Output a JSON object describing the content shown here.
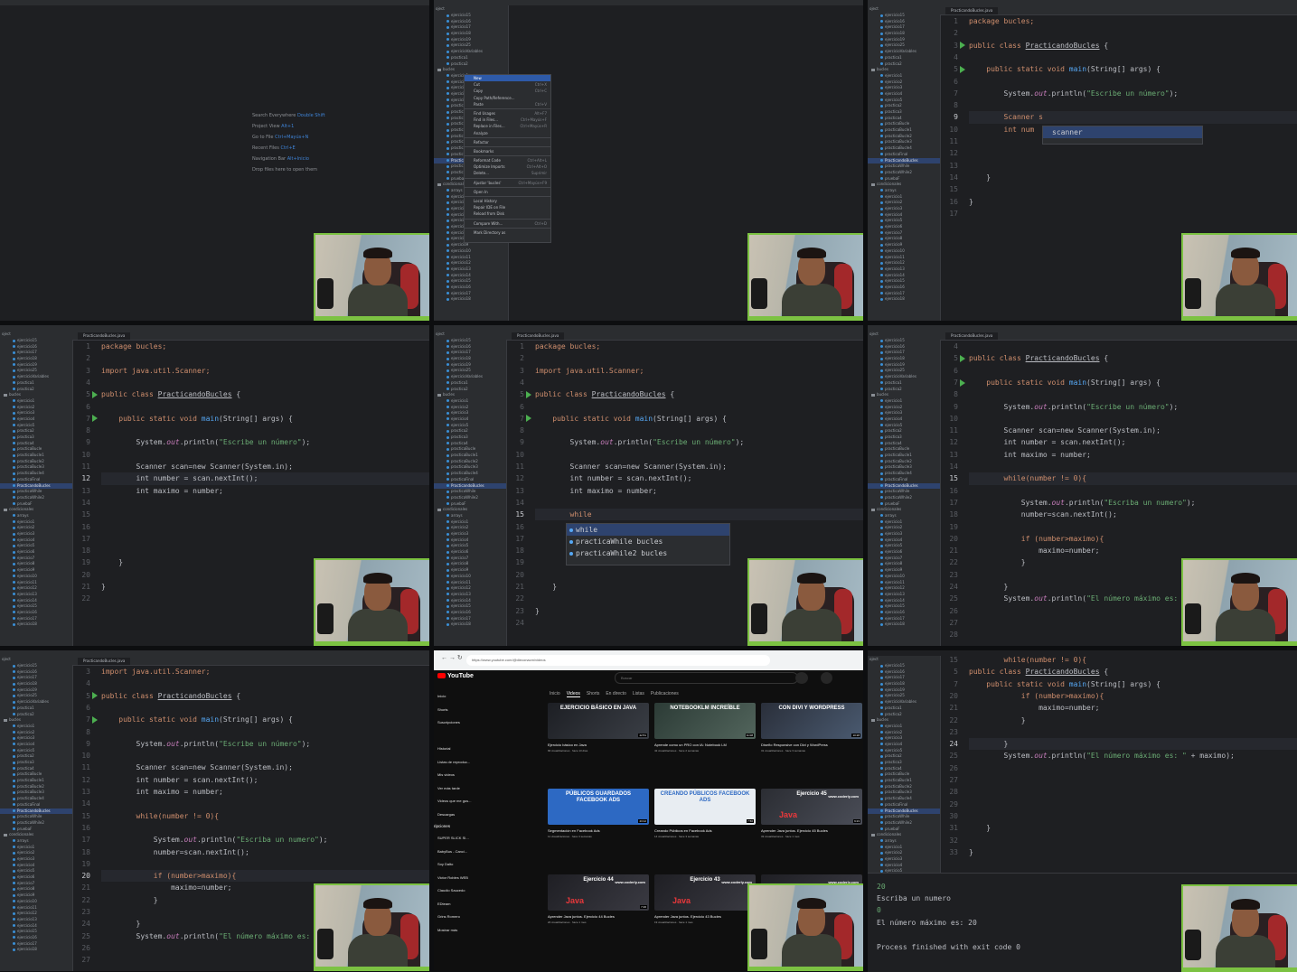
{
  "project_header": "oject",
  "editor_tab": "PracticandoBucles.java",
  "tree_top": [
    "ejercicio15",
    "ejercicio16",
    "ejercicio17",
    "ejercicio18",
    "ejercicio19",
    "ejercicio25",
    "ejercicioVariables",
    "practica1",
    "practica2"
  ],
  "tree_bucles": "bucles",
  "tree_bucles_items": [
    "ejercicio1",
    "ejercicio2",
    "ejercicio3",
    "ejercicio4",
    "ejercicio5",
    "practica2",
    "practica3",
    "practica4",
    "practicaBucle",
    "practicaBucle1",
    "practicaBucle2",
    "practicaBucle3",
    "practicaBucle4",
    "practicaFinal",
    "PracticandoBucles",
    "practicaWhile",
    "practicaWhile2",
    "pruebaF"
  ],
  "tree_condicionales": "condicionales",
  "tree_cond_items": [
    "arrays",
    "ejercicio1",
    "ejercicio2",
    "ejercicio3",
    "ejercicio4",
    "ejercicio5",
    "ejercicio6",
    "ejercicio7",
    "ejercicio8",
    "ejercicio9",
    "ejercicio10",
    "ejercicio11",
    "ejercicio12",
    "ejercicio13",
    "ejercicio14",
    "ejercicio15",
    "ejercicio16",
    "ejercicio17",
    "ejercicio18"
  ],
  "welcome": {
    "search_everywhere": "Search Everywhere",
    "search_everywhere_key": "Double Shift",
    "project_view": "Project View",
    "project_view_key": "Alt+1",
    "goto_file": "Go to File",
    "goto_file_key": "Ctrl+Mayús+N",
    "recent_files": "Recent Files",
    "recent_files_key": "Ctrl+E",
    "nav_bar": "Navigation Bar",
    "nav_bar_key": "Alt+Inicio",
    "drop_files": "Drop files here to open them"
  },
  "context_menu": [
    {
      "label": "New",
      "shortcut": "",
      "selected": true
    },
    {
      "label": "Cut",
      "shortcut": "Ctrl+X"
    },
    {
      "label": "Copy",
      "shortcut": "Ctrl+C"
    },
    {
      "label": "Copy Path/Reference...",
      "shortcut": ""
    },
    {
      "label": "Paste",
      "shortcut": "Ctrl+V"
    },
    {
      "sep": true
    },
    {
      "label": "Find Usages",
      "shortcut": "Alt+F7"
    },
    {
      "label": "Find in Files...",
      "shortcut": "Ctrl+Mayús+F"
    },
    {
      "label": "Replace in Files...",
      "shortcut": "Ctrl+Mayús+R"
    },
    {
      "label": "Analyze",
      "shortcut": ""
    },
    {
      "sep": true
    },
    {
      "label": "Refactor",
      "shortcut": ""
    },
    {
      "sep": true
    },
    {
      "label": "Bookmarks",
      "shortcut": ""
    },
    {
      "sep": true
    },
    {
      "label": "Reformat Code",
      "shortcut": "Ctrl+Alt+L"
    },
    {
      "label": "Optimize Imports",
      "shortcut": "Ctrl+Alt+O"
    },
    {
      "label": "Delete...",
      "shortcut": "Suprimir"
    },
    {
      "sep": true
    },
    {
      "label": "Ajustar 'bucles'",
      "shortcut": "Ctrl+Mayús+F9"
    },
    {
      "sep": true
    },
    {
      "label": "Open In",
      "shortcut": ""
    },
    {
      "sep": true
    },
    {
      "label": "Local History",
      "shortcut": ""
    },
    {
      "label": "Repair IDE on File",
      "shortcut": ""
    },
    {
      "label": "Reload from Disk",
      "shortcut": ""
    },
    {
      "sep": true
    },
    {
      "label": "Compare With...",
      "shortcut": "Ctrl+D"
    },
    {
      "sep": true
    },
    {
      "label": "Mark Directory as",
      "shortcut": ""
    }
  ],
  "code": {
    "package": "package bucles;",
    "import": "import java.util.Scanner;",
    "class_kw": "public class ",
    "class_name": "PracticandoBucles",
    "main_kw": "public static void ",
    "main_name": "main",
    "main_args": "(String[] args) {",
    "println_pre": "System.",
    "println_out": "out",
    "println_mid": ".println(",
    "str_escribe": "\"Escribe un número\"",
    "str_escriba": "\"Escriba un numero\"",
    "scanner_line": "Scanner scan=new Scanner(System.in);",
    "int_number": "int number = scan.nextInt();",
    "int_maximo": "int maximo = number;",
    "while_line": "while(number != 0){",
    "number_next": "number=scan.nextInt();",
    "if_line": "if (number>maximo){",
    "maximo_assign": "maximo=number;",
    "str_max": "\"El número máximo es: \"",
    "plus_maximo": " + maximo);",
    "close_brace": "}",
    "typing_scanner": "Scanner s",
    "typing_int": "int num",
    "typing_while": "while"
  },
  "autocomplete_scanner": [
    "scanner"
  ],
  "autocomplete_while": [
    "while",
    "practicaWhile  bucles",
    "practicaWhile2  bucles"
  ],
  "console": {
    "in1": "20",
    "out1": "Escriba un numero",
    "in2": "0",
    "out2": "El número máximo es: 20",
    "out3": "Process finished with exit code 0"
  },
  "youtube": {
    "url": "https://www.youtube.com/@dieconacm/videos",
    "logo": "YouTube",
    "search_placeholder": "Buscar",
    "tabs": [
      "Inicio",
      "Videos",
      "Shorts",
      "En directo",
      "Listas",
      "Publicaciones"
    ],
    "active_tab": "Videos",
    "sidebar": [
      "Inicio",
      "Shorts",
      "Suscripciones",
      "",
      "Historial",
      "Listas de reproduc...",
      "Mis videos",
      "Ver más tarde",
      "Videos que me gus...",
      "Descargas"
    ],
    "subs_header": "ripciones",
    "subs": [
      "SUPER SLICK SI...",
      "BabyBus - Canci...",
      "Soy Dalto",
      "Victor Robles WEB",
      "Claudio Saucedo",
      "EDteam",
      "Grins Romero",
      "Mostrar más"
    ],
    "videos": [
      {
        "title": "Ejercicio básico en Java",
        "meta": "90 visualizaciones · hace 13 días",
        "thumb": "EJERCICIO BÁSICO EN JAVA",
        "dur": "22:51"
      },
      {
        "title": "Aprende como un PRO con IA: Notebook LM",
        "meta": "42 visualizaciones · hace 2 semanas",
        "thumb": "NOTEBOOKLM INCREÍBLE",
        "dur": "11:08"
      },
      {
        "title": "Diseño Responsive con Divi y WordPress",
        "meta": "31 visualizaciones · hace 3 semanas",
        "thumb": "CON DIVI Y WORDPRESS",
        "dur": "10:28"
      },
      {
        "title": "Segmentación en Facebook Ads",
        "meta": "11 visualizaciones · hace 3 semanas",
        "thumb": "PÚBLICOS GUARDADOS FACEBOOK ADS",
        "dur": "23:12"
      },
      {
        "title": "Creando Públicos en Facebook Ads",
        "meta": "14 visualizaciones · hace 3 semanas",
        "thumb": "CREANDO PÚBLICOS FACEBOOK ADS",
        "dur": "7:56"
      },
      {
        "title": "Aprender Java juntos. Ejercicio 45 Bucles",
        "meta": "33 visualizaciones · hace 1 mes",
        "thumb": "Ejercicio 45",
        "dur": "9:23"
      },
      {
        "title": "Aprender Java juntos. Ejercicio 44 Bucles",
        "meta": "20 visualizaciones · hace 1 mes",
        "thumb": "Ejercicio 44",
        "dur": "7:26"
      },
      {
        "title": "Aprender Java juntos. Ejercicio 43 Bucles",
        "meta": "19 visualizaciones · hace 1 mes",
        "thumb": "Ejercicio 43",
        "dur": ""
      },
      {
        "title": "",
        "meta": "",
        "thumb": "",
        "dur": ""
      }
    ],
    "coderly": "www.coderly.com",
    "java": "Java"
  }
}
